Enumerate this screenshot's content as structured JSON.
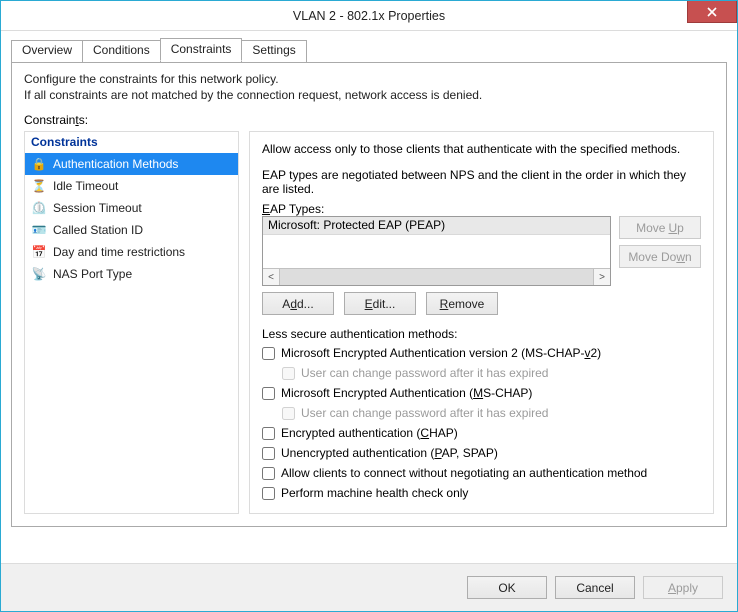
{
  "window": {
    "title": "VLAN 2 - 802.1x Properties"
  },
  "tabs": {
    "overview": "Overview",
    "conditions": "Conditions",
    "constraints": "Constraints",
    "settings": "Settings",
    "active": "Constraints"
  },
  "intro_line1": "Configure the constraints for this network policy.",
  "intro_line2": "If all constraints are not matched by the connection request, network access is denied.",
  "constraints_label": "Constraints:",
  "sidebar": {
    "header": "Constraints",
    "items": [
      {
        "label": "Authentication Methods",
        "icon": "lock-icon",
        "selected": true
      },
      {
        "label": "Idle Timeout",
        "icon": "idle-icon",
        "selected": false
      },
      {
        "label": "Session Timeout",
        "icon": "session-icon",
        "selected": false
      },
      {
        "label": "Called Station ID",
        "icon": "station-icon",
        "selected": false
      },
      {
        "label": "Day and time restrictions",
        "icon": "calendar-icon",
        "selected": false
      },
      {
        "label": "NAS Port Type",
        "icon": "port-icon",
        "selected": false
      }
    ]
  },
  "main": {
    "line1": "Allow access only to those clients that authenticate with the specified methods.",
    "line2": "EAP types are negotiated between NPS and the client in the order in which they are listed.",
    "eap_label": "EAP Types:",
    "eap_items": [
      "Microsoft: Protected EAP (PEAP)"
    ],
    "move_up": "Move Up",
    "move_down": "Move Down",
    "add": "Add...",
    "edit": "Edit...",
    "remove": "Remove",
    "less_label": "Less secure authentication methods:",
    "cb": {
      "mschap2": "Microsoft Encrypted Authentication version 2 (MS-CHAP-v2)",
      "mschap2_expired": "User can change password after it has expired",
      "mschap": "Microsoft Encrypted Authentication (MS-CHAP)",
      "mschap_expired": "User can change password after it has expired",
      "chap": "Encrypted authentication (CHAP)",
      "pap": "Unencrypted authentication (PAP, SPAP)",
      "noneg": "Allow clients to connect without negotiating an authentication method",
      "healthonly": "Perform machine health check only"
    }
  },
  "buttons": {
    "ok": "OK",
    "cancel": "Cancel",
    "apply": "Apply"
  }
}
